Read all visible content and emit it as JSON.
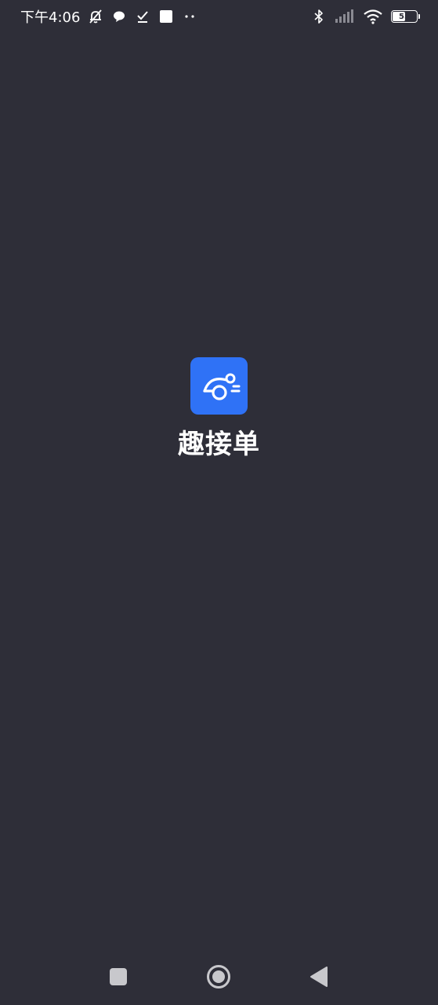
{
  "status_bar": {
    "time": "下午4:06",
    "battery_level": "55",
    "battery_percent": 55,
    "icons": [
      "muted-bell-icon",
      "chat-bubble-icon",
      "download-check-icon",
      "square-notification-icon",
      "more-dots-icon",
      "bluetooth-icon",
      "signal-icon",
      "wifi-icon",
      "battery-icon"
    ]
  },
  "splash": {
    "app_name": "趣接单",
    "icon": "app-logo-icon",
    "icon_color": "#2f72f6"
  },
  "nav_bar": {
    "buttons": [
      "recent-apps-icon",
      "home-icon",
      "back-icon"
    ]
  },
  "colors": {
    "background": "#2e2e38",
    "foreground": "#ffffff",
    "accent": "#2f72f6"
  }
}
